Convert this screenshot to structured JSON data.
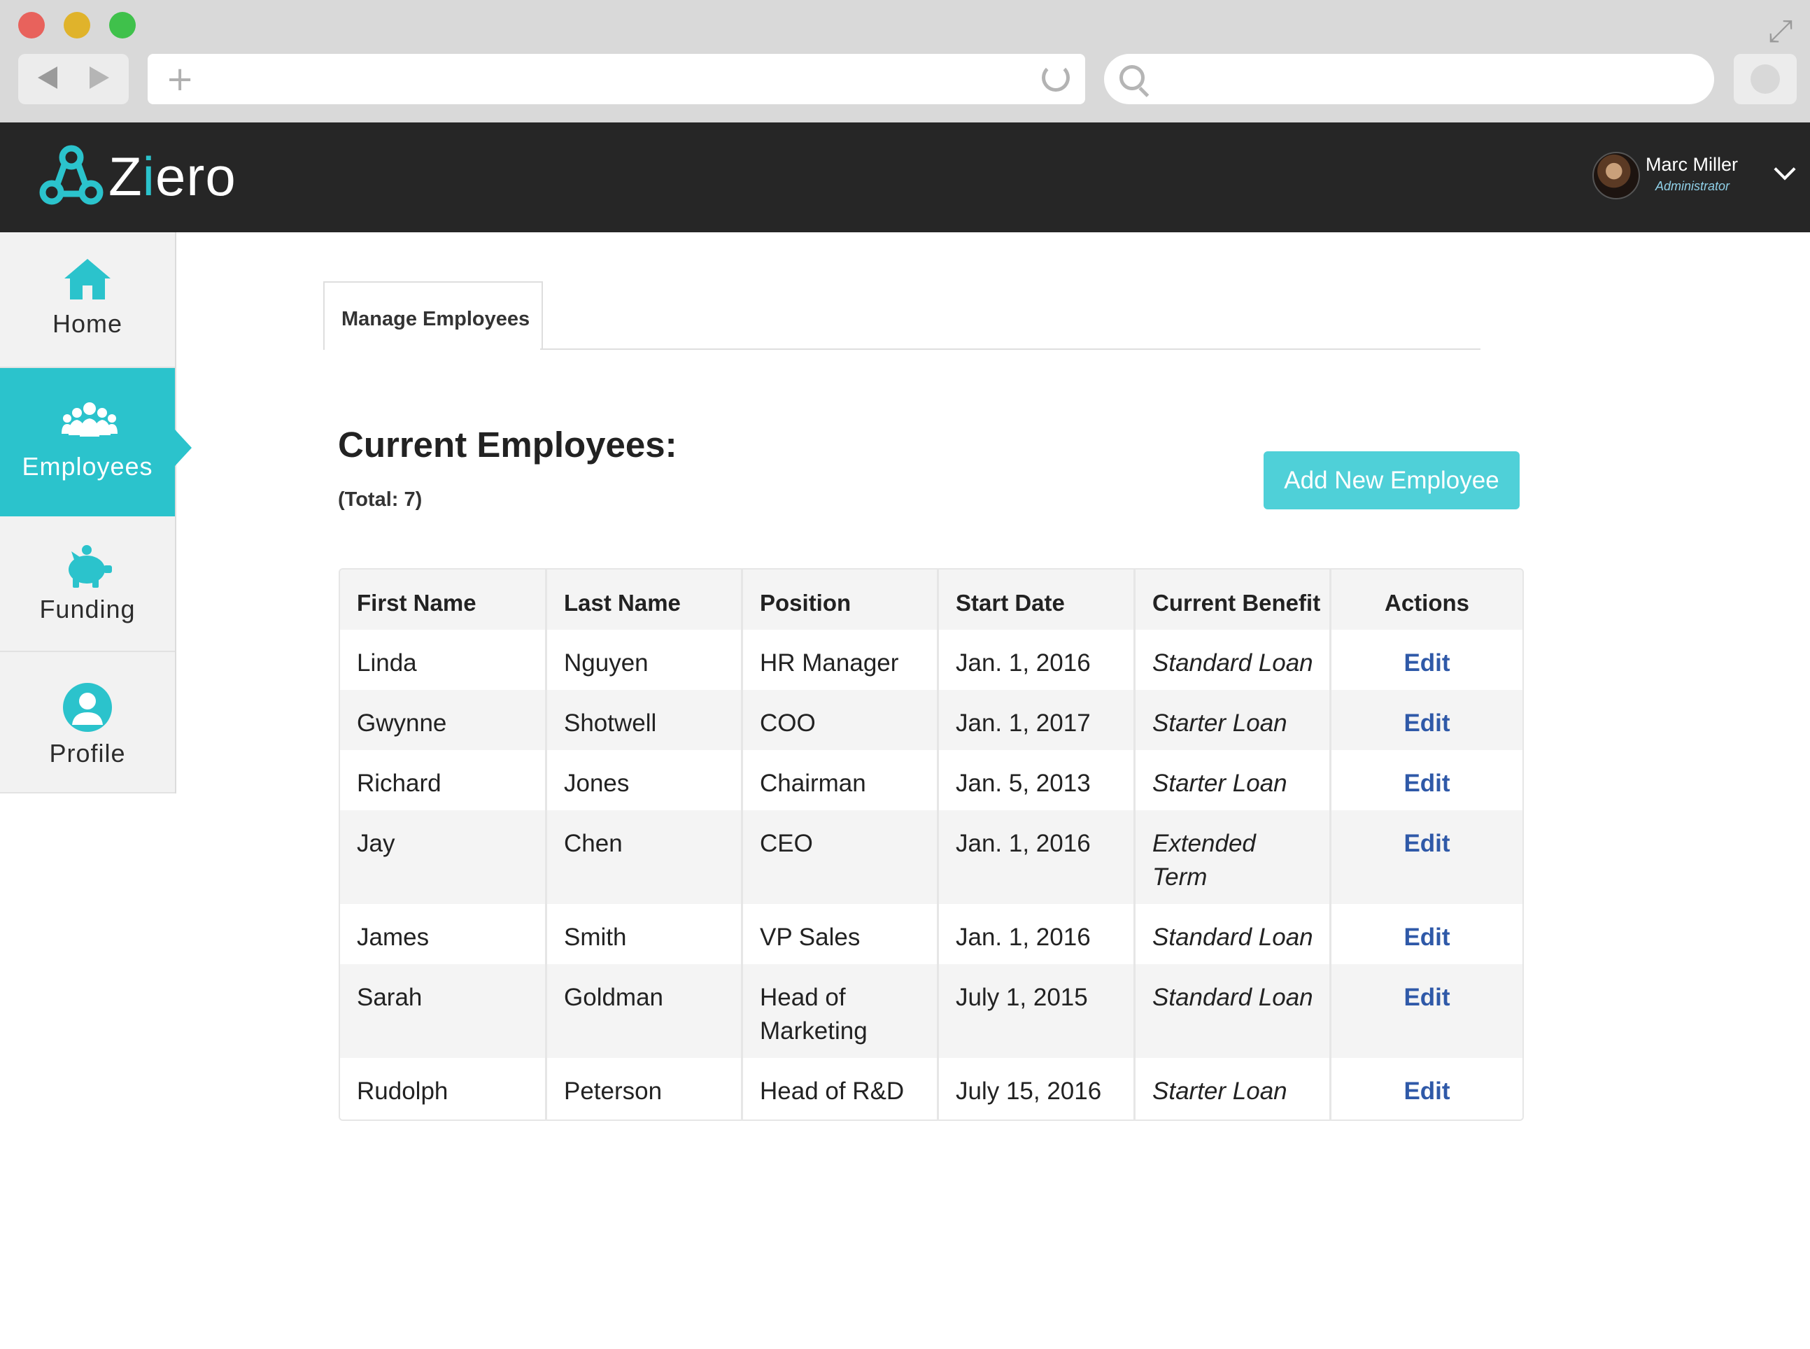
{
  "browser": {
    "icons": [
      "back-icon",
      "forward-icon",
      "plus-icon",
      "reload-icon",
      "search-icon",
      "expand-icon"
    ]
  },
  "header": {
    "logo_prefix": "Z",
    "logo_accent": "i",
    "logo_suffix": "ero",
    "user_name": "Marc Miller",
    "user_role": "Administrator"
  },
  "sidebar": {
    "items": [
      {
        "label": "Home",
        "icon": "home-icon"
      },
      {
        "label": "Employees",
        "icon": "group-icon",
        "active": true
      },
      {
        "label": "Funding",
        "icon": "piggy-bank-icon"
      },
      {
        "label": "Profile",
        "icon": "user-icon"
      }
    ]
  },
  "tabs": [
    {
      "label": "Manage Employees"
    }
  ],
  "main": {
    "title": "Current Employees:",
    "total": "(Total: 7)",
    "add_button": "Add New Employee"
  },
  "table": {
    "columns": [
      "First Name",
      "Last Name",
      "Position",
      "Start Date",
      "Current Benefit",
      "Actions"
    ],
    "rows": [
      [
        "Linda",
        "Nguyen",
        "HR Manager",
        "Jan. 1, 2016",
        "Standard Loan",
        "Edit"
      ],
      [
        "Gwynne",
        "Shotwell",
        "COO",
        "Jan. 1, 2017",
        "Starter Loan",
        "Edit"
      ],
      [
        "Richard",
        "Jones",
        "Chairman",
        "Jan. 5, 2013",
        "Starter Loan",
        "Edit"
      ],
      [
        "Jay",
        "Chen",
        "CEO",
        "Jan. 1, 2016",
        "Extended Term",
        "Edit"
      ],
      [
        "James",
        "Smith",
        "VP Sales",
        "Jan. 1, 2016",
        "Standard Loan",
        "Edit"
      ],
      [
        "Sarah",
        "Goldman",
        "Head of Marketing",
        "July 1, 2015",
        "Standard Loan",
        "Edit"
      ],
      [
        "Rudolph",
        "Peterson",
        "Head of R&D",
        "July 15, 2016",
        "Starter Loan",
        "Edit"
      ]
    ]
  },
  "colors": {
    "accent": "#2bc3cc",
    "header_bg": "#262626",
    "link": "#2f59a8",
    "button": "#4fd0d8"
  }
}
